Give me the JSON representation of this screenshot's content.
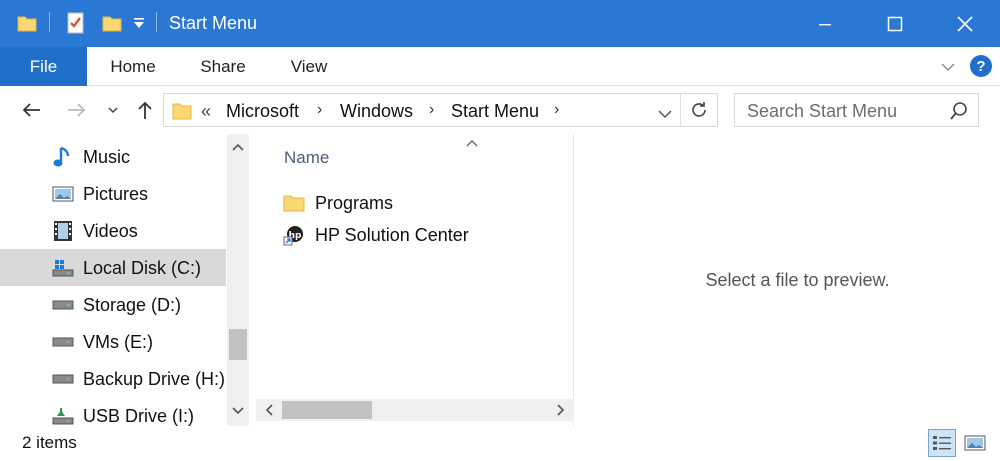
{
  "window": {
    "title": "Start Menu"
  },
  "ribbon": {
    "tabs": [
      "File",
      "Home",
      "Share",
      "View"
    ]
  },
  "address": {
    "overflow": "«",
    "crumbs": [
      "Microsoft",
      "Windows",
      "Start Menu"
    ]
  },
  "search": {
    "placeholder": "Search Start Menu"
  },
  "nav": {
    "items": [
      {
        "label": "Music",
        "icon": "music-icon"
      },
      {
        "label": "Pictures",
        "icon": "pictures-icon"
      },
      {
        "label": "Videos",
        "icon": "videos-icon"
      },
      {
        "label": "Local Disk (C:)",
        "icon": "local-disk-icon",
        "selected": true
      },
      {
        "label": "Storage (D:)",
        "icon": "drive-icon"
      },
      {
        "label": "VMs (E:)",
        "icon": "drive-icon"
      },
      {
        "label": "Backup Drive (H:)",
        "icon": "drive-icon"
      },
      {
        "label": "USB Drive (I:)",
        "icon": "usb-drive-icon"
      }
    ]
  },
  "files": {
    "column_header": "Name",
    "items": [
      {
        "label": "Programs",
        "icon": "folder-icon"
      },
      {
        "label": "HP Solution Center",
        "icon": "shortcut-icon"
      }
    ]
  },
  "preview": {
    "message": "Select a file to preview."
  },
  "status": {
    "item_count": "2 items"
  },
  "colors": {
    "titlebar": "#2b78d4",
    "file_tab": "#1f6fcb",
    "selection": "#d9d9d9"
  }
}
